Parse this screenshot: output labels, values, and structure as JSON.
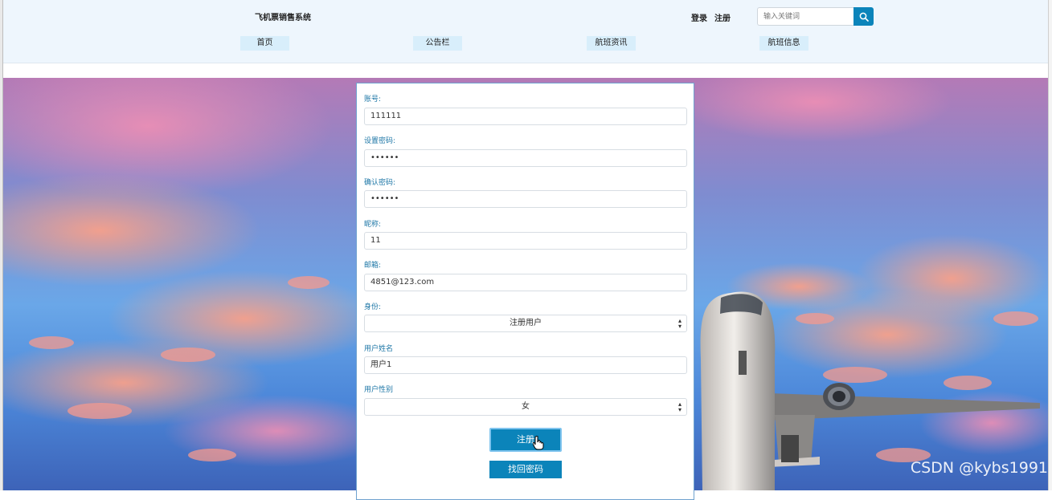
{
  "header": {
    "site_title": "飞机票销售系统",
    "login": "登录",
    "register": "注册",
    "search_placeholder": "输入关键词",
    "nav": [
      "首页",
      "公告栏",
      "航班资讯",
      "航班信息"
    ]
  },
  "form": {
    "fields": [
      {
        "label": "账号:",
        "value": "111111"
      },
      {
        "label": "设置密码:",
        "value": "••••••"
      },
      {
        "label": "确认密码:",
        "value": "••••••"
      },
      {
        "label": "昵称:",
        "value": "11"
      },
      {
        "label": "邮箱:",
        "value": "4851@123.com"
      },
      {
        "label": "身份:",
        "value": "注册用户"
      },
      {
        "label": "用户姓名",
        "value": "用户1"
      },
      {
        "label": "用户性别",
        "value": "女"
      }
    ],
    "submit_label": "注册",
    "forgot_label": "找回密码"
  },
  "watermark": "CSDN @kybs1991",
  "colors": {
    "accent": "#0b84ba",
    "label": "#1c76a6",
    "header_bg": "#eef6fd",
    "nav_bg": "#d8eefb"
  },
  "icons": {
    "search": "search-icon",
    "select": "select-arrow-icon",
    "cursor": "hand-cursor-icon"
  }
}
